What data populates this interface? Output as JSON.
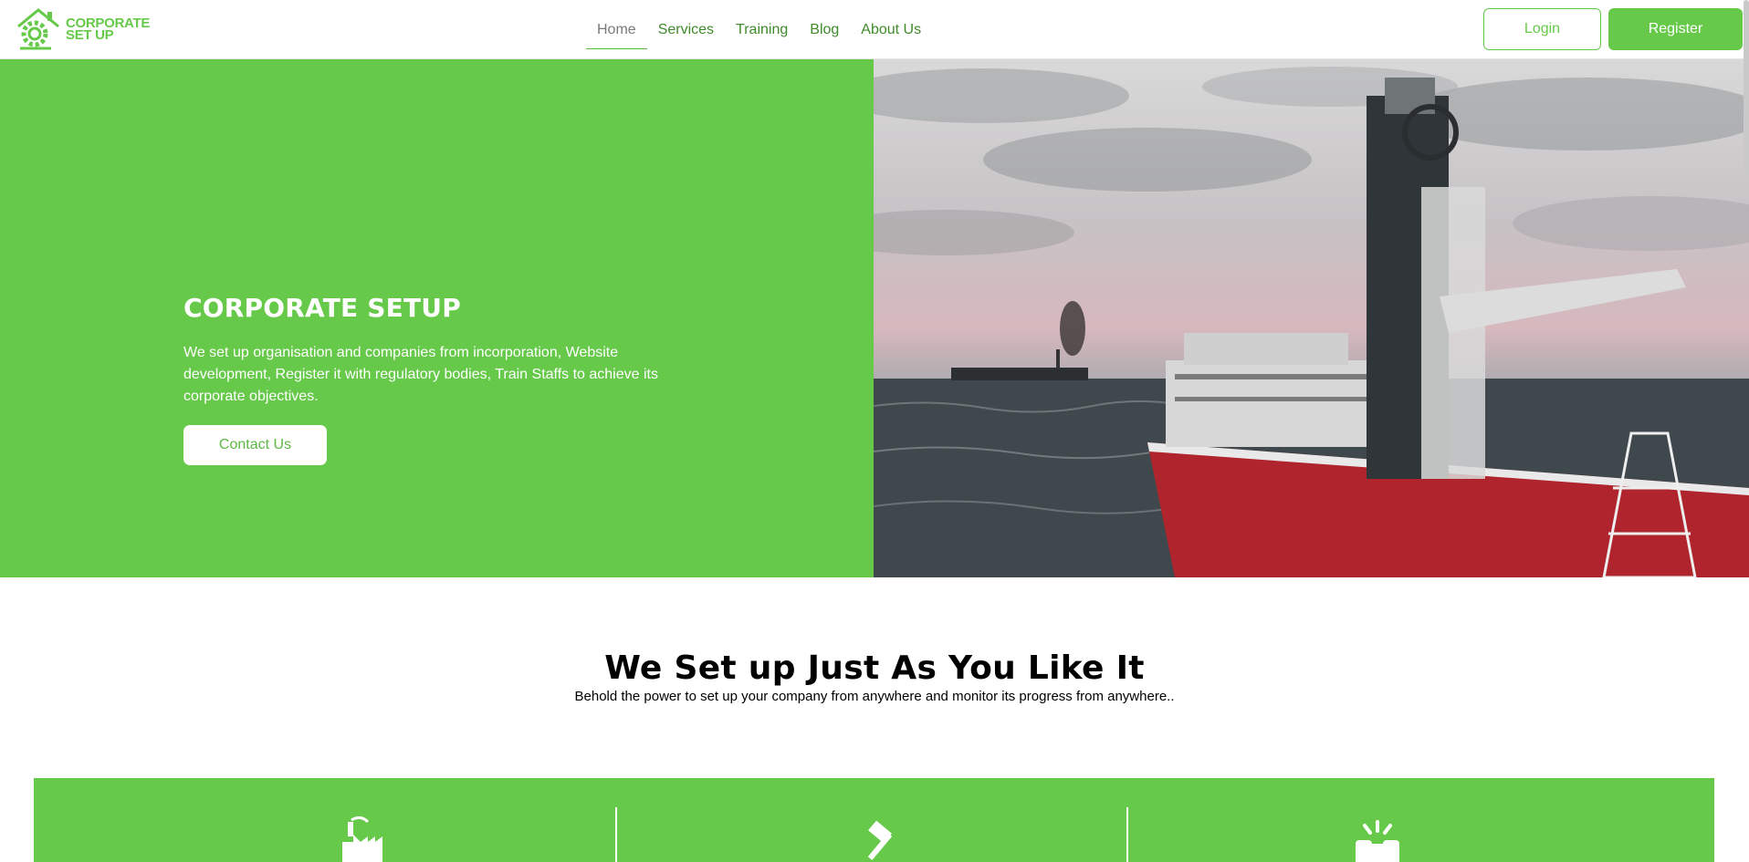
{
  "brand": {
    "name_line1": "CORPORATE",
    "name_line2": "SET UP",
    "color": "#66c94a"
  },
  "nav": {
    "items": [
      {
        "label": "Home",
        "active": true
      },
      {
        "label": "Services",
        "active": false
      },
      {
        "label": "Training",
        "active": false
      },
      {
        "label": "Blog",
        "active": false
      },
      {
        "label": "About Us",
        "active": false
      }
    ]
  },
  "header": {
    "login_label": "Login",
    "register_label": "Register"
  },
  "hero": {
    "title": "CORPORATE SETUP",
    "description": "We set up organisation and companies from incorporation, Website development, Register it with regulatory bodies, Train Staffs to achieve its corporate objectives.",
    "cta_label": "Contact Us",
    "background_color": "#66c94a"
  },
  "intro": {
    "title": "We Set up Just As You Like It",
    "subtitle": "Behold the power to set up your company from anywhere and monitor its progress from anywhere.."
  },
  "features": {
    "icons": [
      "factory-icon",
      "gavel-icon",
      "fist-bump-icon"
    ]
  }
}
